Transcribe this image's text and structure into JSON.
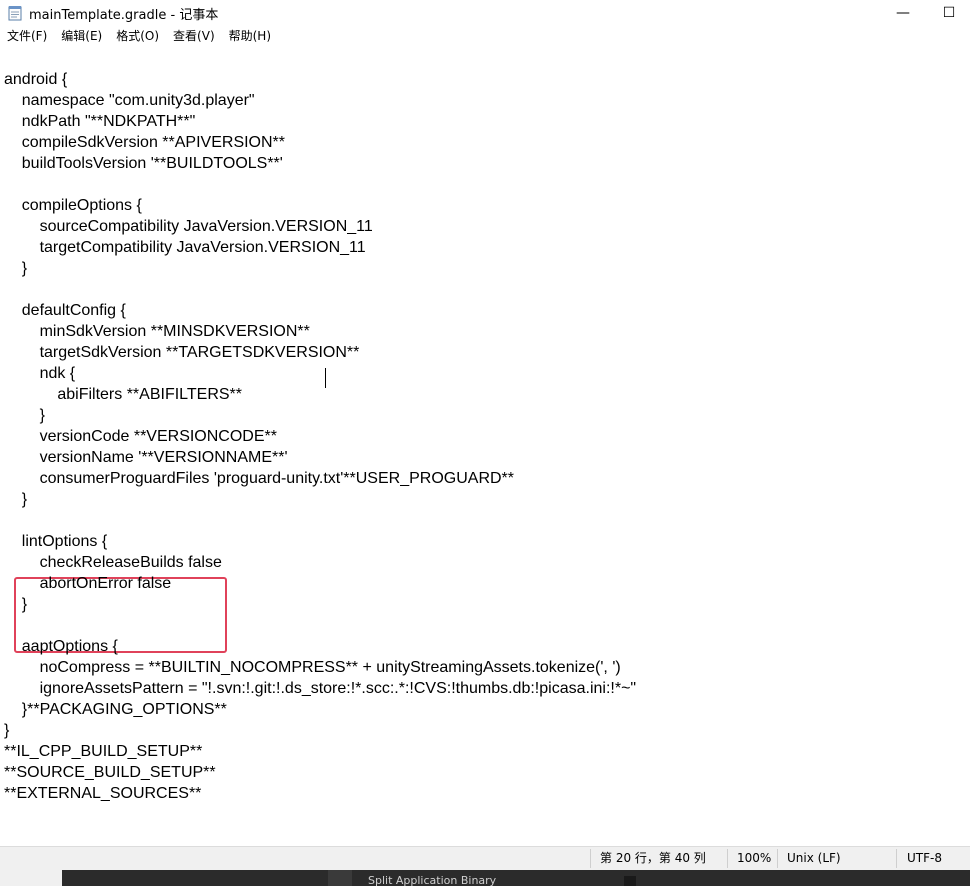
{
  "window": {
    "title": "mainTemplate.gradle - 记事本",
    "minimize_glyph": "—",
    "maximize_glyph": "☐",
    "app_icon": "notepad-icon"
  },
  "menu": [
    "文件(F)",
    "编辑(E)",
    "格式(O)",
    "查看(V)",
    "帮助(H)"
  ],
  "code_lines": [
    "android {",
    "    namespace \"com.unity3d.player\"",
    "    ndkPath \"**NDKPATH**\"",
    "    compileSdkVersion **APIVERSION**",
    "    buildToolsVersion '**BUILDTOOLS**'",
    "",
    "    compileOptions {",
    "        sourceCompatibility JavaVersion.VERSION_11",
    "        targetCompatibility JavaVersion.VERSION_11",
    "    }",
    "",
    "    defaultConfig {",
    "        minSdkVersion **MINSDKVERSION**",
    "        targetSdkVersion **TARGETSDKVERSION**",
    "        ndk {",
    "            abiFilters **ABIFILTERS**",
    "        }",
    "        versionCode **VERSIONCODE**",
    "        versionName '**VERSIONNAME**'",
    "        consumerProguardFiles 'proguard-unity.txt'**USER_PROGUARD**",
    "    }",
    "",
    "    lintOptions {",
    "        checkReleaseBuilds false",
    "        abortOnError false",
    "    }",
    "",
    "    aaptOptions {",
    "        noCompress = **BUILTIN_NOCOMPRESS** + unityStreamingAssets.tokenize(', ')",
    "        ignoreAssetsPattern = \"!.svn:!.git:!.ds_store:!*.scc:.*:!CVS:!thumbs.db:!picasa.ini:!*~\"",
    "    }**PACKAGING_OPTIONS**",
    "}",
    "**IL_CPP_BUILD_SETUP**",
    "**SOURCE_BUILD_SETUP**",
    "**EXTERNAL_SOURCES**"
  ],
  "status": {
    "position": "第 20 行，第 40 列",
    "zoom": "100%",
    "line_ending": "Unix (LF)",
    "encoding": "UTF-8"
  },
  "taskbar": {
    "text": "Split Application Binary"
  },
  "colors": {
    "highlight_border": "#e0425a",
    "statusbar_bg": "#f0f0f0",
    "taskbar_bg": "#2b2b2b"
  }
}
